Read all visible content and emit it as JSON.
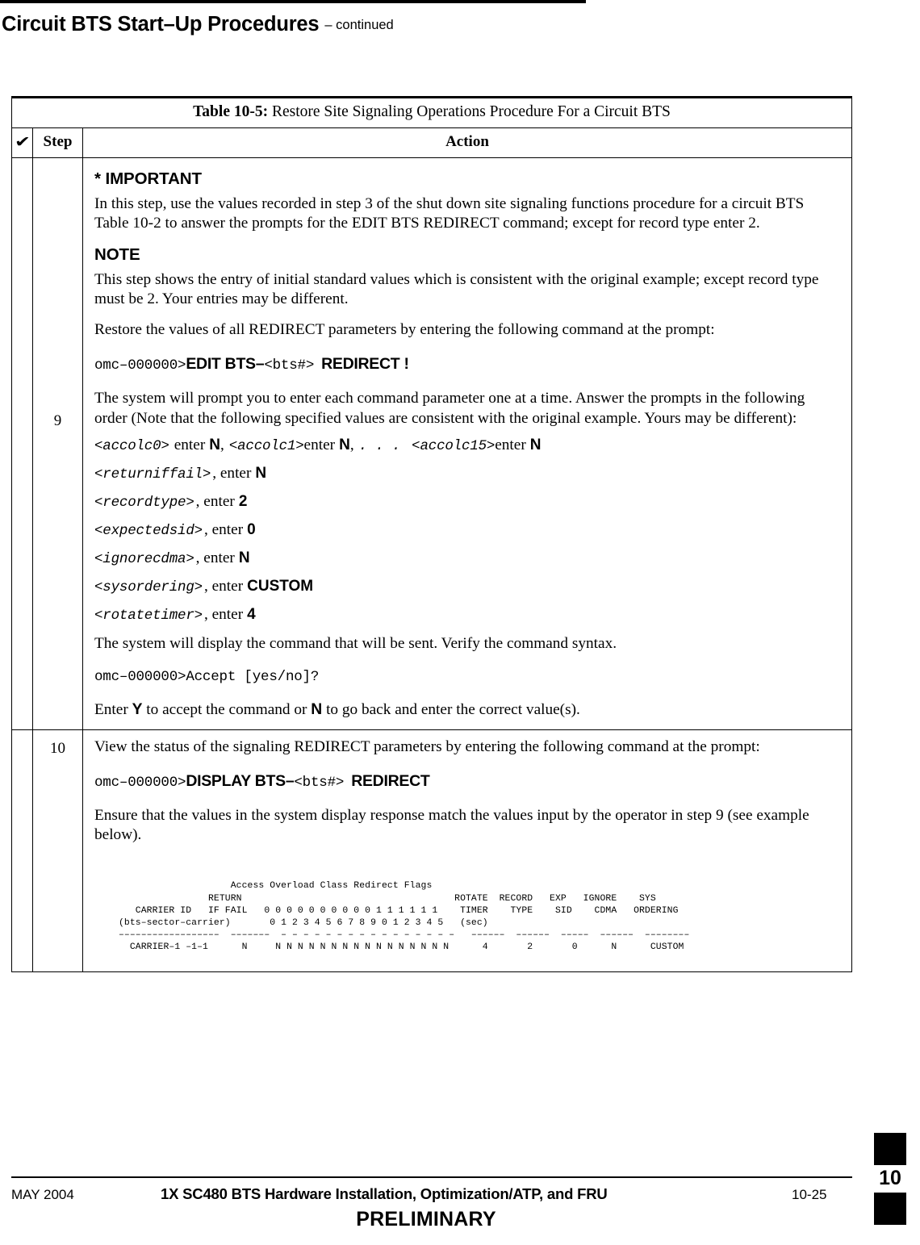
{
  "header": {
    "title": "Circuit BTS Start–Up Procedures",
    "continued": "– continued"
  },
  "table": {
    "caption_label": "Table 10-5:",
    "caption_text": "Restore Site Signaling Operations Procedure For a Circuit BTS",
    "columns": {
      "check_icon": "✔",
      "step": "Step",
      "action": "Action"
    },
    "rows": [
      {
        "step": "9",
        "important_heading": "* IMPORTANT",
        "important_text": "In this step, use the values recorded in step 3 of the shut down site signaling functions procedure for a circuit BTS Table 10-2 to answer the prompts for the EDIT BTS REDIRECT command; except for record type enter 2.",
        "note_heading": "NOTE",
        "note_text": "This step shows the entry of initial standard values which is consistent with the original example; except record type must be 2. Your entries may be different.",
        "intro_text": "Restore the values of all REDIRECT parameters by entering the following command at the prompt:",
        "command": {
          "prompt": "omc–000000>",
          "verb": "EDIT BTS–",
          "arg": "<bts#>",
          "object": "REDIRECT !"
        },
        "prompts_text": "The system will prompt you to enter each command parameter one at a time. Answer the prompts in the following order (Note that the following specified values are consistent with the original example. Yours may be different):",
        "accolc_line": {
          "p0": "<accolc0>",
          "enter0": "enter",
          "v0": "N",
          "comma0": ",",
          "p1": "<accolc1>",
          "enter1": "enter",
          "v1": "N",
          "comma1": ",",
          "ellipsis": ". . .",
          "p15": "<accolc15>",
          "enter15": "enter",
          "v15": "N"
        },
        "parameters": [
          {
            "name": "<returniffail>",
            "sep": ", enter",
            "value": "N"
          },
          {
            "name": "<recordtype>",
            "sep": ", enter",
            "value": "2"
          },
          {
            "name": "<expectedsid>",
            "sep": ", enter",
            "value": "0"
          },
          {
            "name": "<ignorecdma>",
            "sep": ", enter",
            "value": "N"
          },
          {
            "name": "<sysordering>",
            "sep": ", enter",
            "value": "CUSTOM"
          },
          {
            "name": "<rotatetimer>",
            "sep": ", enter",
            "value": "4"
          }
        ],
        "verify_text": "The system will display the command that will be sent. Verify the command syntax.",
        "accept_line": "omc–000000>Accept [yes/no]?",
        "accept_pre": "Enter",
        "accept_yes": "Y",
        "accept_mid": "to accept the command or",
        "accept_no": "N",
        "accept_post": "to go back and enter the correct value(s)."
      },
      {
        "step": "10",
        "intro_text": "View the status of the signaling REDIRECT parameters by entering the following command at the prompt:",
        "command": {
          "prompt": "omc–000000>",
          "verb": "DISPLAY BTS–",
          "arg": "<bts#>",
          "object": "REDIRECT"
        },
        "ensure_text": "Ensure that the values in the system display response match the values input by the operator in step 9 (see example below).",
        "terminal_output": "                    Access Overload Class Redirect Flags\n                RETURN                                      ROTATE  RECORD   EXP   IGNORE    SYS\n   CARRIER ID   IF FAIL   0 0 0 0 0 0 0 0 0 0 1 1 1 1 1 1    TIMER    TYPE    SID    CDMA   ORDERING\n(bts–sector–carrier)       0 1 2 3 4 5 6 7 8 9 0 1 2 3 4 5   (sec)\n––––––––––––––––––  –––––––  – – – – – – – – – – – – – – – –   ––––––  ––––––  –––––  ––––––  ––––––––\n  CARRIER–1 –1–1      N     N N N N N N N N N N N N N N N N      4       2       0      N      CUSTOM"
      }
    ]
  },
  "footer": {
    "date": "MAY 2004",
    "title": "1X SC480 BTS Hardware Installation, Optimization/ATP, and FRU",
    "page": "10-25",
    "status": "PRELIMINARY",
    "chapter_tab": "10"
  }
}
